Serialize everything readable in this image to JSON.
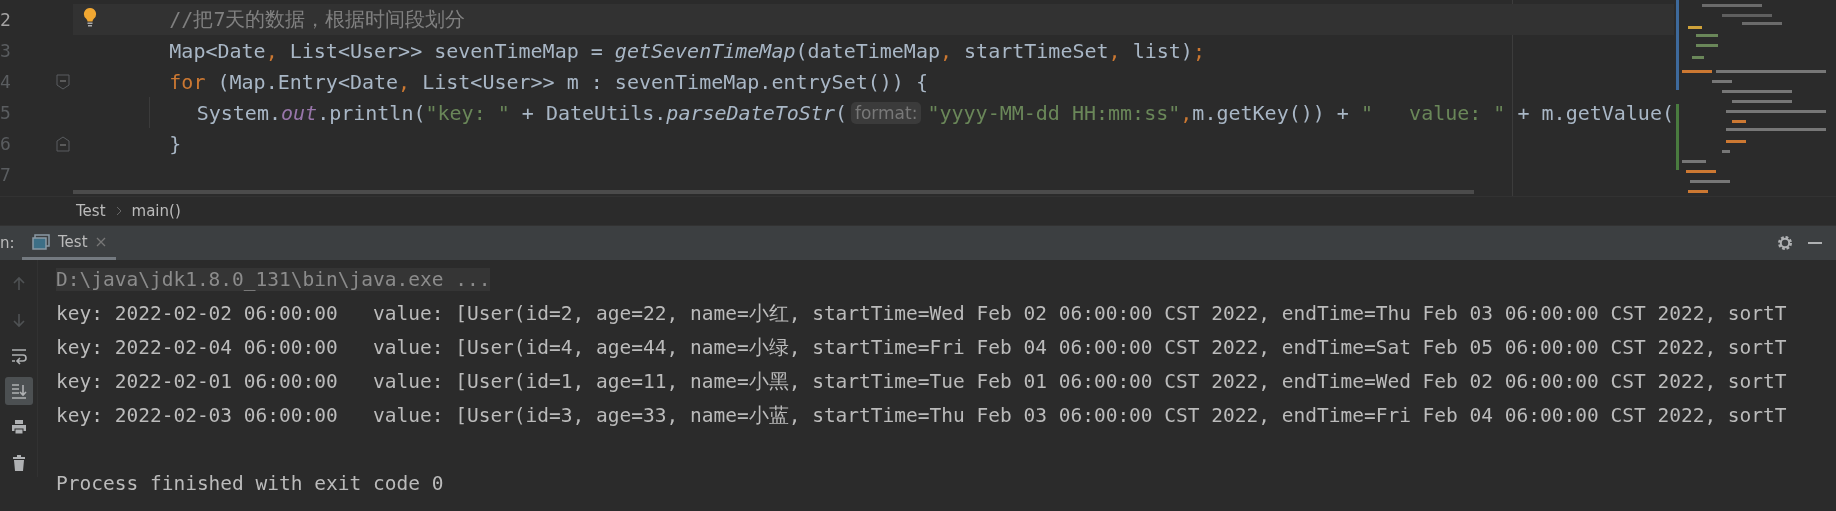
{
  "editor": {
    "lines": [
      {
        "number": "2",
        "kind": "bulb",
        "current": true,
        "tokens": [
          {
            "kind": "comment",
            "text": "//把7天的数据，根据时间段划分"
          }
        ]
      },
      {
        "number": "3",
        "kind": "plain",
        "current": false,
        "tokens": [
          {
            "kind": "plain",
            "text": "Map<Date"
          },
          {
            "kind": "punct",
            "text": ","
          },
          {
            "kind": "plain",
            "text": " List<User>> sevenTimeMap = "
          },
          {
            "kind": "italic",
            "text": "getSevenTimeMap"
          },
          {
            "kind": "plain",
            "text": "(dateTimeMap"
          },
          {
            "kind": "punct",
            "text": ","
          },
          {
            "kind": "plain",
            "text": " startTimeSet"
          },
          {
            "kind": "punct",
            "text": ","
          },
          {
            "kind": "plain",
            "text": " list)"
          },
          {
            "kind": "punct",
            "text": ";"
          }
        ]
      },
      {
        "number": "4",
        "kind": "fold_start",
        "current": false,
        "tokens": [
          {
            "kind": "keyword",
            "text": "for"
          },
          {
            "kind": "plain",
            "text": " (Map.Entry<Date"
          },
          {
            "kind": "punct",
            "text": ","
          },
          {
            "kind": "plain",
            "text": " List<User>> m : sevenTimeMap.entrySet()) {"
          }
        ],
        "children": [
          {
            "number": "5",
            "kind": "plain",
            "current": false,
            "tokens": [
              {
                "kind": "plain",
                "text": "System."
              },
              {
                "kind": "field",
                "text": "out"
              },
              {
                "kind": "plain",
                "text": ".println("
              },
              {
                "kind": "string",
                "text": "\"key: \""
              },
              {
                "kind": "plain",
                "text": " + DateUtils."
              },
              {
                "kind": "italic",
                "text": "parseDateToStr"
              },
              {
                "kind": "plain",
                "text": "("
              },
              {
                "kind": "hint",
                "text": "format:"
              },
              {
                "kind": "string",
                "text": "\"yyyy-MM-dd HH:mm:ss\""
              },
              {
                "kind": "punct",
                "text": ","
              },
              {
                "kind": "plain",
                "text": "m.getKey()) + "
              },
              {
                "kind": "string",
                "text": "\"   value: \""
              },
              {
                "kind": "plain",
                "text": " + m.getValue("
              }
            ]
          }
        ]
      },
      {
        "number": "6",
        "kind": "fold_end",
        "current": false,
        "tokens": [
          {
            "kind": "plain",
            "text": "}"
          }
        ]
      },
      {
        "number": "7",
        "kind": "plain",
        "current": false
      }
    ]
  },
  "breadcrumbs": [
    {
      "label": "Test"
    },
    {
      "label": "main()"
    }
  ],
  "run_panel": {
    "label": "n:",
    "tabs": [
      {
        "label": "Test",
        "selected": true
      }
    ],
    "tools": [
      {
        "kind": "up",
        "disabled": true
      },
      {
        "kind": "down",
        "disabled": true
      },
      {
        "kind": "wrap",
        "disabled": false,
        "on": false
      },
      {
        "kind": "scroll_end",
        "disabled": false,
        "on": true
      },
      {
        "kind": "print",
        "disabled": false
      },
      {
        "kind": "trash",
        "disabled": false
      }
    ],
    "output": [
      {
        "kind": "command",
        "text": "D:\\java\\jdk1.8.0_131\\bin\\java.exe ..."
      },
      {
        "kind": "stdout",
        "text": "key: 2022-02-02 06:00:00   value: [User(id=2, age=22, name=小红, startTime=Wed Feb 02 06:00:00 CST 2022, endTime=Thu Feb 03 06:00:00 CST 2022, sortT"
      },
      {
        "kind": "stdout",
        "text": "key: 2022-02-04 06:00:00   value: [User(id=4, age=44, name=小绿, startTime=Fri Feb 04 06:00:00 CST 2022, endTime=Sat Feb 05 06:00:00 CST 2022, sortT"
      },
      {
        "kind": "stdout",
        "text": "key: 2022-02-01 06:00:00   value: [User(id=1, age=11, name=小黑, startTime=Tue Feb 01 06:00:00 CST 2022, endTime=Wed Feb 02 06:00:00 CST 2022, sortT"
      },
      {
        "kind": "stdout",
        "text": "key: 2022-02-03 06:00:00   value: [User(id=3, age=33, name=小蓝, startTime=Thu Feb 03 06:00:00 CST 2022, endTime=Fri Feb 04 06:00:00 CST 2022, sortT"
      },
      {
        "kind": "exit",
        "text": "Process finished with exit code 0"
      }
    ]
  }
}
